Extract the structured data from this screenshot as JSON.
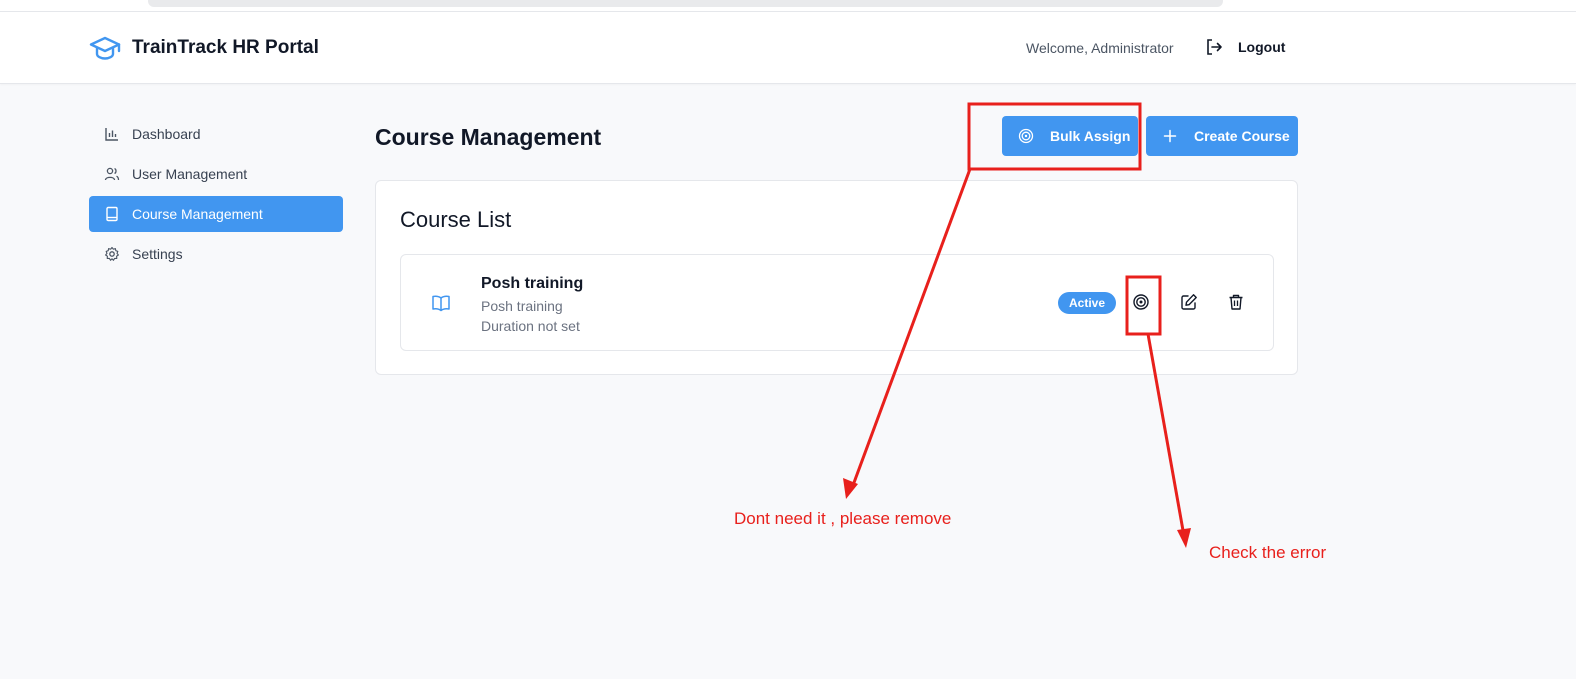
{
  "header": {
    "brand_title": "TrainTrack HR Portal",
    "brand_icon": "graduation-cap-icon",
    "welcome_text": "Welcome, Administrator",
    "logout_label": "Logout",
    "logout_icon": "logout-icon"
  },
  "sidebar": {
    "items": [
      {
        "label": "Dashboard",
        "icon": "bar-chart-icon",
        "active": false
      },
      {
        "label": "User Management",
        "icon": "users-icon",
        "active": false
      },
      {
        "label": "Course Management",
        "icon": "book-icon",
        "active": true
      },
      {
        "label": "Settings",
        "icon": "gear-icon",
        "active": false
      }
    ]
  },
  "main": {
    "title": "Course Management",
    "bulk_assign_label": "Bulk Assign",
    "create_course_label": "Create Course",
    "card_title": "Course List",
    "courses": [
      {
        "name": "Posh training",
        "description": "Posh training",
        "duration": "Duration not set",
        "status": "Active"
      }
    ]
  },
  "annotations": {
    "remove_note": "Dont need it , please remove",
    "error_note": "Check the error"
  },
  "colors": {
    "accent": "#4196f0",
    "annotation": "#e8201c",
    "background": "#f8f9fb"
  }
}
